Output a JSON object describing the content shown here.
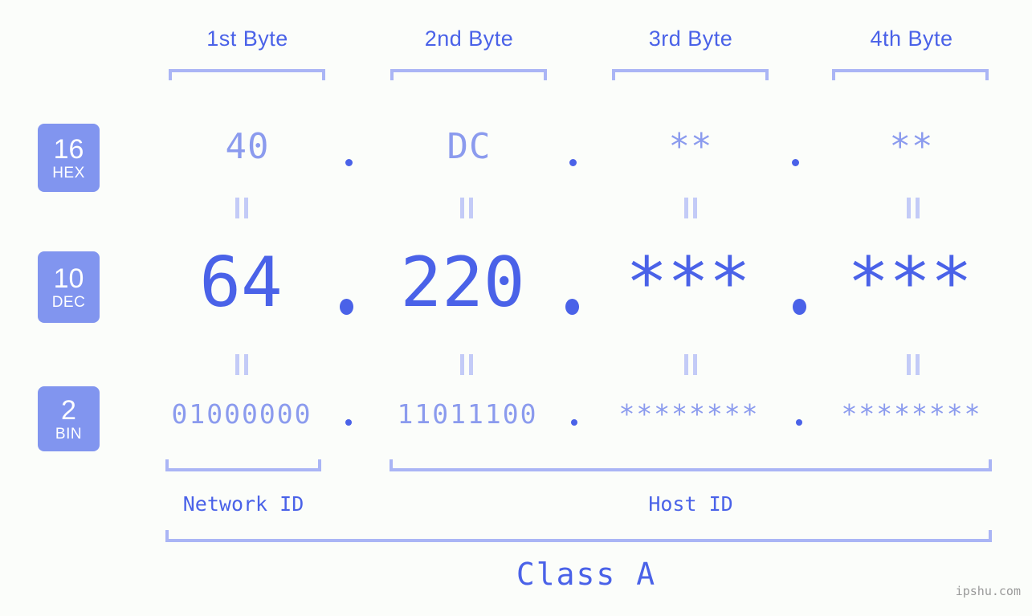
{
  "page": {
    "background": "#fbfdfa",
    "accent_strong": "#4a62e8",
    "accent_light": "#8b9bee",
    "bracket_color": "#aab5f5",
    "badge_bg": "#8195ef",
    "watermark": "ipshu.com"
  },
  "columns": [
    {
      "label": "1st Byte"
    },
    {
      "label": "2nd Byte"
    },
    {
      "label": "3rd Byte"
    },
    {
      "label": "4th Byte"
    }
  ],
  "bases": [
    {
      "num": "16",
      "name": "HEX"
    },
    {
      "num": "10",
      "name": "DEC"
    },
    {
      "num": "2",
      "name": "BIN"
    }
  ],
  "rows": {
    "hex": {
      "base": "16",
      "name": "HEX",
      "values": [
        "40",
        "DC",
        "**",
        "**"
      ]
    },
    "dec": {
      "base": "10",
      "name": "DEC",
      "values": [
        "64",
        "220",
        "***",
        "***"
      ]
    },
    "bin": {
      "base": "2",
      "name": "BIN",
      "values": [
        "01000000",
        "11011100",
        "********",
        "********"
      ]
    }
  },
  "separators": {
    "dot": ".",
    "equals": "||"
  },
  "segments": {
    "network_id": "Network ID",
    "host_id": "Host ID"
  },
  "class": {
    "label": "Class A"
  },
  "address": {
    "hex": "40.DC.**.**",
    "dec": "64.220.***.***",
    "bin": "01000000.11011100.********.********"
  }
}
